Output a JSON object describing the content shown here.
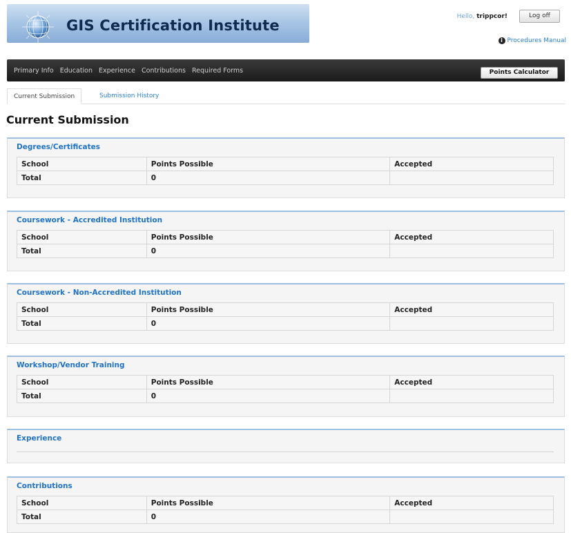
{
  "header": {
    "site_title": "GIS Certification Institute",
    "greeting": "Hello,",
    "username": "trippcor!",
    "logoff_label": "Log off",
    "manual_link": "Procedures Manual"
  },
  "nav": {
    "items": [
      {
        "label": "Primary Info"
      },
      {
        "label": "Education"
      },
      {
        "label": "Experience"
      },
      {
        "label": "Contributions"
      },
      {
        "label": "Required Forms"
      }
    ],
    "calculator_label": "Points Calculator"
  },
  "tabs": {
    "current": "Current Submission",
    "history": "Submission History"
  },
  "page_title": "Current Submission",
  "panels": [
    {
      "title": "Degrees/Certificates",
      "headers": [
        "School",
        "Points Possible",
        "Accepted"
      ],
      "total_label": "Total",
      "total_points": "0"
    },
    {
      "title": "Coursework - Accredited Institution",
      "headers": [
        "School",
        "Points Possible",
        "Accepted"
      ],
      "total_label": "Total",
      "total_points": "0"
    },
    {
      "title": "Coursework - Non-Accredited Institution",
      "headers": [
        "School",
        "Points Possible",
        "Accepted"
      ],
      "total_label": "Total",
      "total_points": "0"
    },
    {
      "title": "Workshop/Vendor Training",
      "headers": [
        "School",
        "Points Possible",
        "Accepted"
      ],
      "total_label": "Total",
      "total_points": "0"
    },
    {
      "title": "Experience"
    },
    {
      "title": "Contributions",
      "headers": [
        "School",
        "Points Possible",
        "Accepted"
      ],
      "total_label": "Total",
      "total_points": "0"
    }
  ],
  "colors": {
    "brand_navy": "#0f2a4f",
    "link_blue": "#1f73c6",
    "navbar_dark": "#222222",
    "panel_bg": "#f5f5f5",
    "panel_border_top": "#9fbfe0"
  },
  "icons": {
    "logo": "globe-logo-icon",
    "manual": "info-circle-icon"
  }
}
